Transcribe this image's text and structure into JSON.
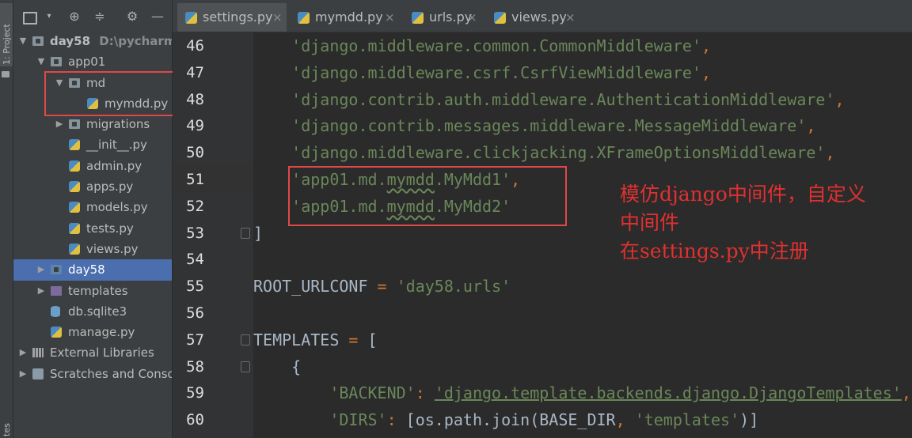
{
  "strip": {
    "project_tab": "1: Project",
    "bottom_tab": "tes"
  },
  "tree": [
    {
      "label": "day58",
      "path": "D:\\pycharm_p",
      "depth": 0,
      "expanded": true,
      "icon": "folder-icon",
      "bold": true
    },
    {
      "label": "app01",
      "depth": 1,
      "expanded": true,
      "icon": "folder-icon"
    },
    {
      "label": "md",
      "depth": 2,
      "expanded": true,
      "icon": "folder-icon"
    },
    {
      "label": "mymdd.py",
      "depth": 3,
      "icon": "python-file-icon"
    },
    {
      "label": "migrations",
      "depth": 2,
      "expanded": false,
      "icon": "folder-icon"
    },
    {
      "label": "__init__.py",
      "depth": 2,
      "icon": "python-file-icon"
    },
    {
      "label": "admin.py",
      "depth": 2,
      "icon": "python-file-icon"
    },
    {
      "label": "apps.py",
      "depth": 2,
      "icon": "python-file-icon"
    },
    {
      "label": "models.py",
      "depth": 2,
      "icon": "python-file-icon"
    },
    {
      "label": "tests.py",
      "depth": 2,
      "icon": "python-file-icon"
    },
    {
      "label": "views.py",
      "depth": 2,
      "icon": "python-file-icon"
    },
    {
      "label": "day58",
      "depth": 1,
      "expanded": false,
      "icon": "folder-icon",
      "selected": true
    },
    {
      "label": "templates",
      "depth": 1,
      "expanded": false,
      "icon": "folder-icon"
    },
    {
      "label": "db.sqlite3",
      "depth": 1,
      "icon": "database-icon"
    },
    {
      "label": "manage.py",
      "depth": 1,
      "icon": "python-file-icon"
    },
    {
      "label": "External Libraries",
      "depth": 0,
      "expanded": false,
      "icon": "library-icon"
    },
    {
      "label": "Scratches and Conso",
      "depth": 0,
      "expanded": false,
      "icon": "scratch-icon"
    }
  ],
  "tabs": [
    {
      "label": "settings.py",
      "active": true
    },
    {
      "label": "mymdd.py",
      "active": false
    },
    {
      "label": "urls.py",
      "active": false
    },
    {
      "label": "views.py",
      "active": false
    }
  ],
  "code_lines": [
    {
      "num": "46",
      "text": "    'django.middleware.common.CommonMiddleware',"
    },
    {
      "num": "47",
      "text": "    'django.middleware.csrf.CsrfViewMiddleware',"
    },
    {
      "num": "48",
      "text": "    'django.contrib.auth.middleware.AuthenticationMiddleware',"
    },
    {
      "num": "49",
      "text": "    'django.contrib.messages.middleware.MessageMiddleware',"
    },
    {
      "num": "50",
      "text": "    'django.middleware.clickjacking.XFrameOptionsMiddleware',"
    },
    {
      "num": "51",
      "text": "    'app01.md.mymdd.MyMdd1',"
    },
    {
      "num": "52",
      "text": "    'app01.md.mymdd.MyMdd2'"
    },
    {
      "num": "53",
      "text": "]"
    },
    {
      "num": "54",
      "text": ""
    },
    {
      "num": "55",
      "text": "ROOT_URLCONF = 'day58.urls'"
    },
    {
      "num": "56",
      "text": ""
    },
    {
      "num": "57",
      "text": "TEMPLATES = ["
    },
    {
      "num": "58",
      "text": "    {"
    },
    {
      "num": "59",
      "text": "        'BACKEND': 'django.template.backends.django.DjangoTemplates',"
    },
    {
      "num": "60",
      "text": "        'DIRS': [os.path.join(BASE_DIR, 'templates')]"
    }
  ],
  "annotation": {
    "line1": "模仿django中间件，自定义",
    "line2": "中间件",
    "line3": "在settings.py中注册"
  },
  "colors": {
    "string": "#6a8759",
    "keyword_op": "#cc7832",
    "text": "#a9b7c6",
    "annotation_red": "#e03030",
    "selection": "#4b6eaf"
  }
}
